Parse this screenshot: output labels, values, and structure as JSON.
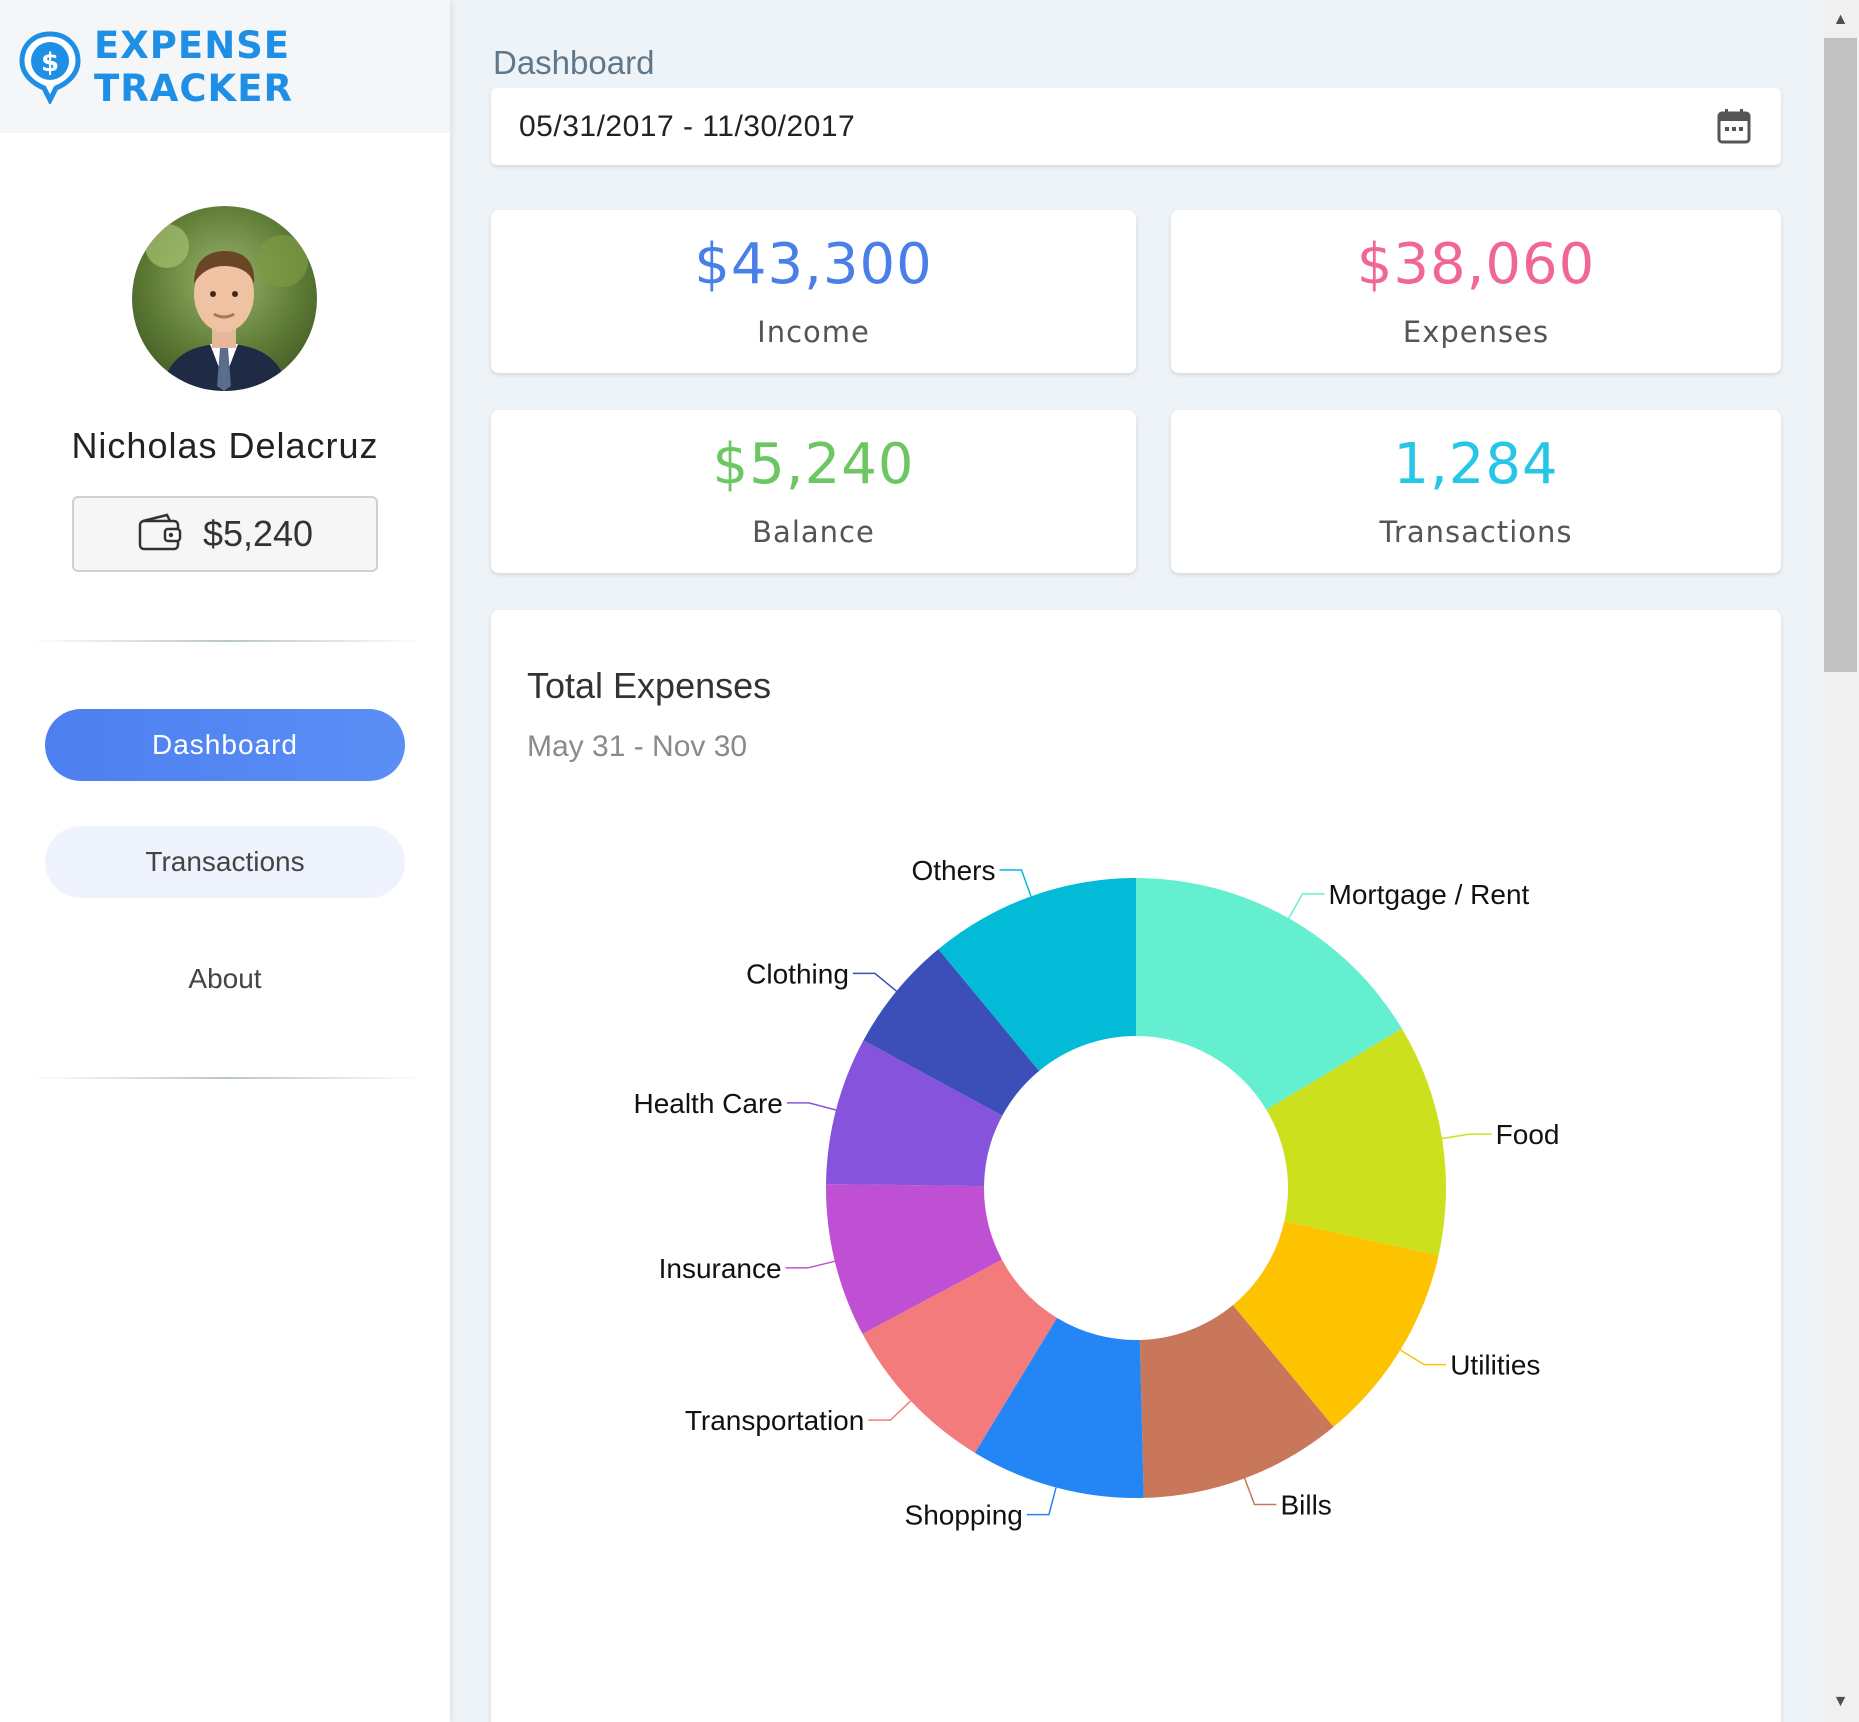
{
  "brand": {
    "title": "EXPENSE TRACKER",
    "logo_symbol": "$"
  },
  "user": {
    "name": "Nicholas Delacruz",
    "wallet_balance": "$5,240"
  },
  "nav": {
    "items": [
      {
        "label": "Dashboard",
        "active": true
      },
      {
        "label": "Transactions",
        "active": false
      },
      {
        "label": "About",
        "active": false
      }
    ]
  },
  "header": {
    "title": "Dashboard",
    "date_range": "05/31/2017 - 11/30/2017"
  },
  "stats": {
    "income": {
      "value": "$43,300",
      "label": "Income",
      "color": "#4a7fe8"
    },
    "expenses": {
      "value": "$38,060",
      "label": "Expenses",
      "color": "#f06795"
    },
    "balance": {
      "value": "$5,240",
      "label": "Balance",
      "color": "#6cc763"
    },
    "transactions": {
      "value": "1,284",
      "label": "Transactions",
      "color": "#26c6e6"
    }
  },
  "chart_data": {
    "type": "pie",
    "title": "Total Expenses",
    "subtitle": "May 31 - Nov 30",
    "donut": true,
    "categories": [
      "Mortgage / Rent",
      "Food",
      "Utilities",
      "Bills",
      "Shopping",
      "Transportation",
      "Insurance",
      "Health Care",
      "Clothing",
      "Others"
    ],
    "values": [
      16.4,
      12.1,
      10.5,
      10.6,
      9.1,
      8.5,
      8.0,
      7.7,
      6.1,
      11.0
    ],
    "colors": [
      "#64efd0",
      "#cde01e",
      "#fdc300",
      "#c9775b",
      "#2486f5",
      "#f47b7b",
      "#c050d3",
      "#8654dc",
      "#3c4eb8",
      "#03bbd6"
    ]
  }
}
